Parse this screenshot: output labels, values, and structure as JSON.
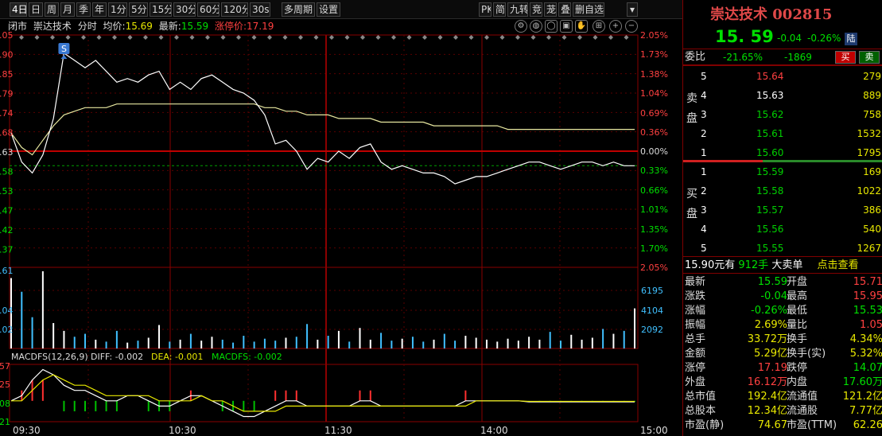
{
  "toolbar": {
    "period_items": [
      "4日",
      "日",
      "周",
      "月",
      "季",
      "年",
      "1分",
      "5分",
      "15分",
      "30分",
      "60分",
      "120分",
      "30s",
      "多周期",
      "设置"
    ],
    "tools_items": [
      "PK",
      "简",
      "九转",
      "竞",
      "茏",
      "叠",
      "删自选"
    ]
  },
  "chart": {
    "market_status": "闭市",
    "stock_name": "崇达技术",
    "mode": "分时",
    "avg_label": "均价:",
    "avg_value": "15.69",
    "latest_label": "最新:",
    "latest_value": "15.59",
    "limit_label": "涨停价:",
    "limit_value": "17.19",
    "signal_label": "S",
    "right_pct_labels_upper": [
      "2.05%",
      "1.73%",
      "1.38%",
      "1.04%",
      "0.69%",
      "0.36%",
      "0.00%"
    ],
    "right_pct_labels_lower": [
      "0.33%",
      "0.66%",
      "1.01%",
      "1.35%",
      "1.70%",
      "2.05%"
    ],
    "left_price_labels": [
      ".05",
      ".90",
      ".85",
      ".79",
      ".74",
      ".68",
      ".63",
      ".58",
      ".53",
      ".47",
      ".42",
      ".37"
    ],
    "volume_labels": [
      "6195",
      "4104",
      "2092"
    ],
    "left_volume_labels": [
      ".61",
      ".04",
      ".02"
    ],
    "macd_title": "MACDFS(12,26,9)",
    "macd_diff": "DIFF: -0.002",
    "macd_dea": "DEA: -0.001",
    "macd_macdfs": "MACDFS: -0.002",
    "macd_left_labels": [
      "57",
      "25",
      "08",
      "21"
    ],
    "time_labels": [
      "09:30",
      "10:30",
      "11:30",
      "14:00",
      "15:00"
    ]
  },
  "chart_data": {
    "type": "line",
    "title": "",
    "series": [
      {
        "name": "",
        "values": [
          15.68,
          15.6,
          15.57,
          15.62,
          15.72,
          15.9,
          15.88,
          15.86,
          15.88,
          15.85,
          15.82,
          15.83,
          15.82,
          15.84,
          15.85,
          15.8,
          15.82,
          15.8,
          15.83,
          15.84,
          15.82,
          15.8,
          15.79,
          15.77,
          15.73,
          15.65,
          15.66,
          15.63,
          15.58,
          15.61,
          15.6,
          15.63,
          15.61,
          15.64,
          15.65,
          15.6,
          15.58,
          15.59,
          15.58,
          15.57,
          15.57,
          15.56,
          15.54,
          15.55,
          15.56,
          15.56,
          15.57,
          15.58,
          15.59,
          15.6,
          15.6,
          15.59,
          15.58,
          15.59,
          15.6,
          15.6,
          15.59,
          15.6,
          15.59,
          15.59
        ]
      },
      {
        "name": "",
        "values": [
          15.68,
          15.64,
          15.62,
          15.66,
          15.7,
          15.73,
          15.74,
          15.75,
          15.75,
          15.75,
          15.76,
          15.76,
          15.76,
          15.76,
          15.76,
          15.76,
          15.76,
          15.76,
          15.76,
          15.76,
          15.76,
          15.76,
          15.76,
          15.76,
          15.75,
          15.75,
          15.74,
          15.74,
          15.73,
          15.73,
          15.73,
          15.72,
          15.72,
          15.72,
          15.72,
          15.71,
          15.71,
          15.71,
          15.71,
          15.71,
          15.7,
          15.7,
          15.7,
          15.7,
          15.7,
          15.7,
          15.7,
          15.69,
          15.69,
          15.69,
          15.69,
          15.69,
          15.69,
          15.69,
          15.69,
          15.69,
          15.69,
          15.69,
          15.69,
          15.69
        ]
      }
    ],
    "x": [
      "09:30",
      "10:30",
      "11:30",
      "14:00",
      "15:00"
    ],
    "prev_close": 15.63,
    "ylim": [
      15.31,
      15.95
    ],
    "volume_range": [
      0,
      8300
    ],
    "volume": [
      7200,
      5800,
      3200,
      7900,
      2600,
      1800,
      1200,
      1500,
      900,
      700,
      1800,
      600,
      800,
      1100,
      2400,
      700,
      900,
      1500,
      800,
      1200,
      900,
      600,
      1300,
      700,
      1000,
      800,
      1100,
      1200,
      2500,
      900,
      1300,
      1800,
      700,
      2100,
      900,
      1600,
      800,
      1000,
      1200,
      700,
      900,
      1500,
      800,
      1300,
      1100,
      900,
      700,
      1000,
      800,
      1200,
      900,
      1700,
      800,
      1400,
      900,
      1100,
      2000,
      1500,
      1800,
      4100
    ],
    "macd_diff": [
      0.0,
      0.01,
      0.04,
      0.06,
      0.05,
      0.03,
      0.02,
      0.02,
      0.01,
      0.0,
      0.0,
      0.01,
      0.01,
      0.0,
      -0.01,
      -0.01,
      0.0,
      0.01,
      0.01,
      0.0,
      -0.01,
      -0.02,
      -0.03,
      -0.03,
      -0.02,
      -0.01,
      0.0,
      0.0,
      -0.01,
      -0.01,
      -0.01,
      -0.01,
      -0.01,
      0.0,
      0.0,
      -0.01,
      -0.01,
      -0.01,
      -0.01,
      -0.01,
      -0.01,
      -0.01,
      -0.01,
      0.0,
      0.0,
      0.0,
      0.0,
      0.0,
      0.0,
      -0.002,
      -0.002,
      -0.002,
      -0.002,
      -0.002,
      -0.002,
      -0.002,
      -0.002,
      -0.002,
      -0.002,
      -0.002
    ],
    "macd_dea": [
      0.0,
      0.0,
      0.02,
      0.04,
      0.05,
      0.04,
      0.03,
      0.03,
      0.02,
      0.01,
      0.01,
      0.01,
      0.01,
      0.01,
      0.0,
      0.0,
      0.0,
      0.0,
      0.01,
      0.0,
      0.0,
      -0.01,
      -0.02,
      -0.02,
      -0.02,
      -0.02,
      -0.01,
      -0.01,
      -0.01,
      -0.01,
      -0.01,
      -0.01,
      -0.01,
      -0.01,
      -0.01,
      -0.01,
      -0.01,
      -0.01,
      -0.01,
      -0.01,
      -0.01,
      -0.01,
      -0.01,
      -0.01,
      0.0,
      0.0,
      0.0,
      0.0,
      0.0,
      -0.001,
      -0.001,
      -0.001,
      -0.001,
      -0.001,
      -0.001,
      -0.001,
      -0.001,
      -0.001,
      -0.001,
      -0.001
    ],
    "macd_range": [
      -0.04,
      0.07
    ],
    "grid": true
  },
  "colors": {
    "up": "#ff4040",
    "down": "#00d000",
    "price_line": "#ffffff",
    "avg_line": "#e8e8a0",
    "grid": "#8a0000",
    "neutral": "#e8e800"
  },
  "stock": {
    "name": "崇达技术 002815",
    "price": "15. 59",
    "change": "-0.04",
    "change_pct": "-0.26%",
    "market_badge": "陆"
  },
  "weibi": {
    "label": "委比",
    "pct": "-21.65%",
    "diff": "-1869",
    "buy_btn": "买",
    "sell_btn": "卖"
  },
  "orderbook": {
    "sell_side_label": "卖盘",
    "buy_side_label": "买盘",
    "asks": [
      {
        "level": "5",
        "price": "15.64",
        "vol": "279"
      },
      {
        "level": "4",
        "price": "15.63",
        "vol": "889"
      },
      {
        "level": "3",
        "price": "15.62",
        "vol": "758"
      },
      {
        "level": "2",
        "price": "15.61",
        "vol": "1532"
      },
      {
        "level": "1",
        "price": "15.60",
        "vol": "1795"
      }
    ],
    "bids": [
      {
        "level": "1",
        "price": "15.59",
        "vol": "169"
      },
      {
        "level": "2",
        "price": "15.58",
        "vol": "1022"
      },
      {
        "level": "3",
        "price": "15.57",
        "vol": "386"
      },
      {
        "level": "4",
        "price": "15.56",
        "vol": "540"
      },
      {
        "level": "5",
        "price": "15.55",
        "vol": "1267"
      }
    ]
  },
  "big_order": {
    "price_text": "15.90元有",
    "vol_text": "912手",
    "kind": "大卖单",
    "link": "点击查看"
  },
  "stats": [
    {
      "k1": "最新",
      "v1": "15.59",
      "c1": "#00e000",
      "k2": "开盘",
      "v2": "15.71",
      "c2": "#ff4040"
    },
    {
      "k1": "涨跌",
      "v1": "-0.04",
      "c1": "#00e000",
      "k2": "最高",
      "v2": "15.95",
      "c2": "#ff4040"
    },
    {
      "k1": "涨幅",
      "v1": "-0.26%",
      "c1": "#00e000",
      "k2": "最低",
      "v2": "15.53",
      "c2": "#00e000"
    },
    {
      "k1": "振幅",
      "v1": "2.69%",
      "c1": "#e8e800",
      "k2": "量比",
      "v2": "1.05",
      "c2": "#ff4040"
    },
    {
      "k1": "总手",
      "v1": "33.72万",
      "c1": "#e8e800",
      "k2": "换手",
      "v2": "4.34%",
      "c2": "#e8e800"
    },
    {
      "k1": "金额",
      "v1": "5.29亿",
      "c1": "#e8e800",
      "k2": "换手(实)",
      "v2": "5.32%",
      "c2": "#e8e800"
    },
    {
      "k1": "涨停",
      "v1": "17.19",
      "c1": "#ff4040",
      "k2": "跌停",
      "v2": "14.07",
      "c2": "#00e000"
    },
    {
      "k1": "外盘",
      "v1": "16.12万",
      "c1": "#ff4040",
      "k2": "内盘",
      "v2": "17.60万",
      "c2": "#00e000"
    },
    {
      "k1": "总市值",
      "v1": "192.4亿",
      "c1": "#e8e800",
      "k2": "流通值",
      "v2": "121.2亿",
      "c2": "#e8e800"
    },
    {
      "k1": "总股本",
      "v1": "12.34亿",
      "c1": "#e8e800",
      "k2": "流通股",
      "v2": "7.77亿",
      "c2": "#e8e800"
    },
    {
      "k1": "市盈(静)",
      "v1": "74.67",
      "c1": "#e8e800",
      "k2": "市盈(TTM)",
      "v2": "62.26",
      "c2": "#e8e800"
    }
  ]
}
